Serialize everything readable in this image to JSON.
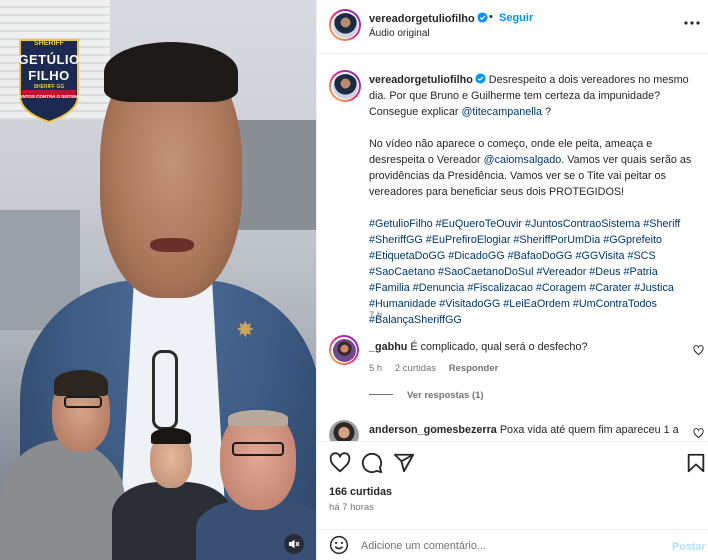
{
  "media": {
    "logo": {
      "top": "SHERIFF",
      "line1": "GETÚLIO",
      "line2": "FILHO",
      "sub": "SHERIFF GG",
      "motto": "JUNTOS CONTRA O SISTEMA"
    },
    "mute_icon": "speaker-mute-icon"
  },
  "header": {
    "username": "vereadorgetuliofilho",
    "verified_icon": "verified-badge-icon",
    "separator": "•",
    "follow_label": "Seguir",
    "audio": "Áudio original",
    "more_icon": "more-options-icon"
  },
  "caption": {
    "username": "vereadorgetuliofilho",
    "para1_text": "Desrespeito a dois vereadores no mesmo dia. Por que Bruno e Guilherme tem certeza da impunidade? Consegue explicar",
    "para1_mention": "@titecampanella",
    "para1_end": "?",
    "para2_start": "No vídeo não aparece o começo, onde ele peita, ameaça e desrespeita o Vereador",
    "para2_mention": "@caiomsalgado",
    "para2_end": ". Vamos ver quais serão as providências da Presidência. Vamos ver se o Tite vai peitar os vereadores para beneficiar seus dois PROTEGIDOS!",
    "hashtags": "#GetulioFilho #EuQueroTeOuvir #JuntosContraoSistema #Sheriff #SheriffGG #EuPrefiroElogiar #SheriffPorUmDia #GGprefeito #EtiquetaDoGG #DicadoGG #BafaoDoGG #GGVisita #SCS #SaoCaetano #SaoCaetanoDoSul #Vereador #Deus #Patria #Familia #Denuncia #Fiscalizacao #Coragem #Carater #Justica #Humanidade #VisitadoGG #LeiEaOrdem #UmContraTodos #BalançaSheriffGG",
    "time": "7 h"
  },
  "comments": [
    {
      "username": "_gabhu",
      "text": "É complicado, qual será o desfecho?",
      "time": "5 h",
      "likes": "2 curtidas",
      "reply_label": "Responder",
      "view_replies": "Ver respostas (1)"
    },
    {
      "username": "anderson_gomesbezerra",
      "text": "Poxa vida até quem fim apareceu 1 a"
    }
  ],
  "actions": {
    "like_icon": "heart-icon",
    "comment_icon": "comment-icon",
    "share_icon": "share-icon",
    "save_icon": "bookmark-icon",
    "likes_count": "166 curtidas",
    "time_ago": "há 7 horas"
  },
  "add_comment": {
    "emoji_icon": "emoji-icon",
    "placeholder": "Adicione um comentário...",
    "post_label": "Postar",
    "post_color": "#b2dffc"
  },
  "colors": {
    "link": "#00376b",
    "follow": "#0095f6",
    "muted": "#737373"
  }
}
